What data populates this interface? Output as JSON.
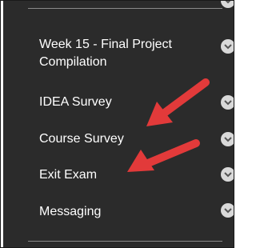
{
  "menu": {
    "items": [
      {
        "label": "Week 15 - Final Project Compilation"
      },
      {
        "label": "IDEA Survey"
      },
      {
        "label": "Course Survey"
      },
      {
        "label": "Exit Exam"
      },
      {
        "label": "Messaging"
      }
    ]
  },
  "icons": {
    "expand": "chevron-down-icon",
    "annotation": "red-arrow-icon"
  },
  "colors": {
    "panel_background": "#2b2b2b",
    "text": "#ffffff",
    "chevron_circle": "#d9d9d9",
    "annotation_arrow": "#e23a3a"
  }
}
